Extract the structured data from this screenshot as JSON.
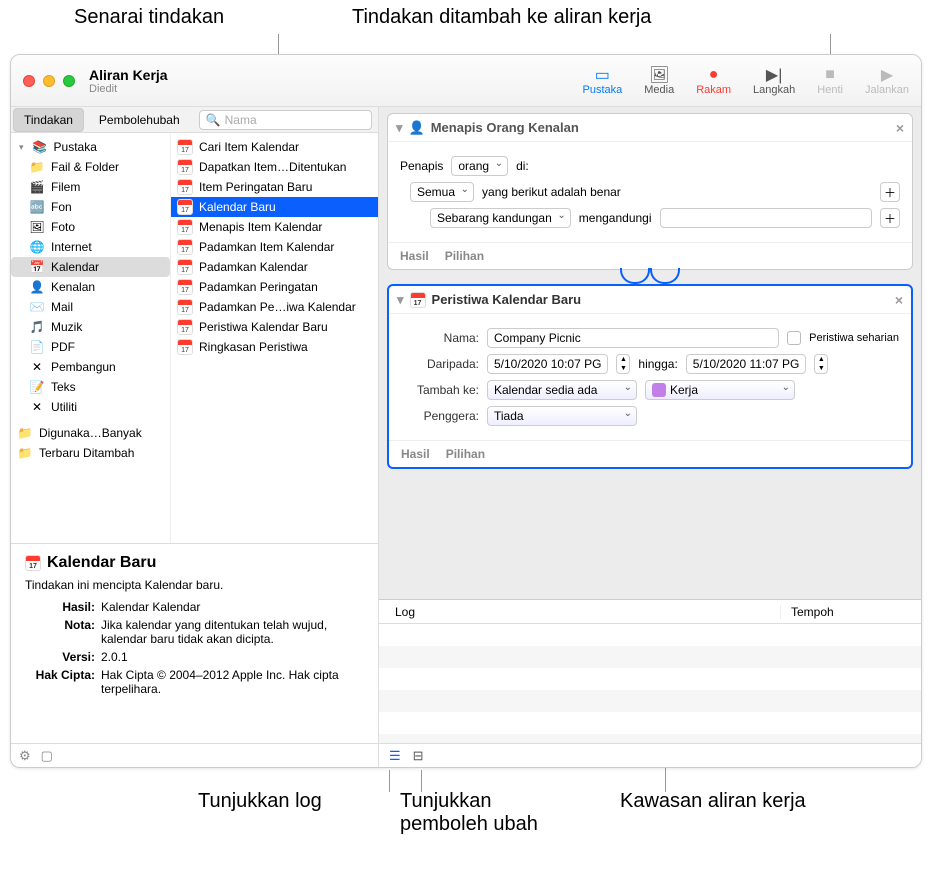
{
  "callouts": {
    "top_left": "Senarai tindakan",
    "top_right": "Tindakan ditambah ke aliran kerja",
    "bottom_left": "Tunjukkan log",
    "bottom_mid": "Tunjukkan pemboleh ubah",
    "bottom_right": "Kawasan aliran kerja"
  },
  "window": {
    "title": "Aliran Kerja",
    "subtitle": "Diedit"
  },
  "toolbar": {
    "library": "Pustaka",
    "media": "Media",
    "record": "Rakam",
    "step": "Langkah",
    "stop": "Henti",
    "run": "Jalankan"
  },
  "tabs": {
    "actions": "Tindakan",
    "variables": "Pembolehubah"
  },
  "search": {
    "placeholder": "Nama"
  },
  "library": {
    "root": "Pustaka",
    "items": [
      "Fail & Folder",
      "Filem",
      "Fon",
      "Foto",
      "Internet",
      "Kalendar",
      "Kenalan",
      "Mail",
      "Muzik",
      "PDF",
      "Pembangun",
      "Teks",
      "Utiliti"
    ],
    "extras": [
      "Digunaka…Banyak",
      "Terbaru Ditambah"
    ],
    "selected": "Kalendar"
  },
  "actions": {
    "items": [
      "Cari Item Kalendar",
      "Dapatkan Item…Ditentukan",
      "Item Peringatan Baru",
      "Kalendar Baru",
      "Menapis Item Kalendar",
      "Padamkan Item Kalendar",
      "Padamkan Kalendar",
      "Padamkan Peringatan",
      "Padamkan Pe…iwa Kalendar",
      "Peristiwa Kalendar Baru",
      "Ringkasan Peristiwa"
    ],
    "selected": "Kalendar Baru"
  },
  "info": {
    "title": "Kalendar Baru",
    "desc": "Tindakan ini mencipta Kalendar baru.",
    "hasil_k": "Hasil:",
    "hasil_v": "Kalendar Kalendar",
    "nota_k": "Nota:",
    "nota_v": "Jika kalendar yang ditentukan telah wujud, kalendar baru tidak akan dicipta.",
    "versi_k": "Versi:",
    "versi_v": "2.0.1",
    "hak_k": "Hak Cipta:",
    "hak_v": "Hak Cipta © 2004–2012 Apple Inc.  Hak cipta terpelihara."
  },
  "wf1": {
    "title": "Menapis Orang Kenalan",
    "penapis": "Penapis",
    "orang": "orang",
    "di": "di:",
    "semua": "Semua",
    "yang": "yang berikut adalah benar",
    "sebarang": "Sebarang kandungan",
    "mengandungi": "mengandungi",
    "hasil": "Hasil",
    "pilihan": "Pilihan"
  },
  "wf2": {
    "title": "Peristiwa Kalendar Baru",
    "nama_k": "Nama:",
    "nama_v": "Company Picnic",
    "seharian": "Peristiwa seharian",
    "dari_k": "Daripada:",
    "dari_v": "5/10/2020 10:07 PG",
    "hingga": "hingga:",
    "hingga_v": "5/10/2020 11:07 PG",
    "tambah_k": "Tambah ke:",
    "tambah_v": "Kalendar sedia ada",
    "kerja": "Kerja",
    "peng_k": "Penggera:",
    "peng_v": "Tiada",
    "hasil": "Hasil",
    "pilihan": "Pilihan"
  },
  "log": {
    "col1": "Log",
    "col2": "Tempoh"
  }
}
